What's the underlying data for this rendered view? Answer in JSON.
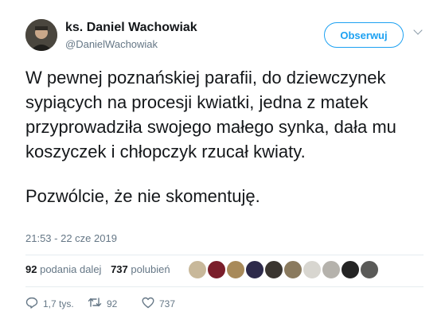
{
  "author": {
    "name": "ks. Daniel Wachowiak",
    "handle": "@DanielWachowiak"
  },
  "follow_label": "Obserwuj",
  "tweet_text": [
    "W pewnej poznańskiej parafii, do dziewczynek sypiących na procesji kwiatki, jedna z matek przyprowadziła swojego małego synka, dała mu koszyczek i chłopczyk rzucał kwiaty.",
    "Pozwólcie, że nie skomentuję."
  ],
  "timestamp": "21:53 - 22 cze 2019",
  "stats": {
    "retweets_count": "92",
    "retweets_label": "podania dalej",
    "likes_count": "737",
    "likes_label": "polubień"
  },
  "actions": {
    "reply_count": "1,7 tys.",
    "retweet_count": "92",
    "like_count": "737"
  },
  "colors": {
    "accent": "#1da1f2",
    "secondary_text": "#657786",
    "divider": "#e6ecf0"
  },
  "icons": [
    "chevron-down-icon",
    "reply-icon",
    "retweet-icon",
    "like-icon"
  ]
}
